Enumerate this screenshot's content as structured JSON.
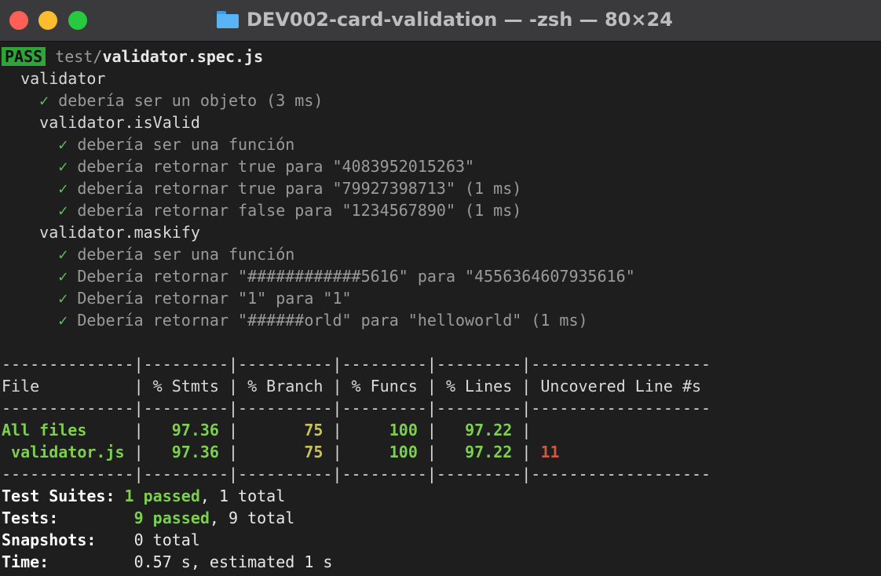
{
  "window": {
    "title": "DEV002-card-validation — -zsh — 80×24",
    "folder_icon": "folder-icon"
  },
  "run": {
    "status": "PASS",
    "file_dir": "test/",
    "file_name": "validator.spec.js"
  },
  "suite": {
    "name": "validator",
    "tests": [
      {
        "check": "✓",
        "text": "debería ser un objeto (3 ms)"
      }
    ],
    "groups": [
      {
        "name": "validator.isValid",
        "tests": [
          {
            "check": "✓",
            "text": "debería ser una función"
          },
          {
            "check": "✓",
            "text": "debería retornar true para \"4083952015263\""
          },
          {
            "check": "✓",
            "text": "debería retornar true para \"79927398713\" (1 ms)"
          },
          {
            "check": "✓",
            "text": "debería retornar false para \"1234567890\" (1 ms)"
          }
        ]
      },
      {
        "name": "validator.maskify",
        "tests": [
          {
            "check": "✓",
            "text": "debería ser una función"
          },
          {
            "check": "✓",
            "text": "Debería retornar \"############5616\" para \"4556364607935616\""
          },
          {
            "check": "✓",
            "text": "Debería retornar \"1\" para \"1\""
          },
          {
            "check": "✓",
            "text": "Debería retornar \"######orld\" para \"helloworld\" (1 ms)"
          }
        ]
      }
    ]
  },
  "coverage": {
    "separator": "--------------|---------|----------|---------|---------|-------------------",
    "headers": [
      "File",
      "% Stmts",
      "% Branch",
      "% Funcs",
      "% Lines",
      "Uncovered Line #s"
    ],
    "rows": [
      {
        "file": "All files",
        "stmts": "97.36",
        "branch": "75",
        "funcs": "100",
        "lines": "97.22",
        "uncovered": ""
      },
      {
        "file": " validator.js",
        "stmts": "97.36",
        "branch": "75",
        "funcs": "100",
        "lines": "97.22",
        "uncovered": "11"
      }
    ]
  },
  "summary": {
    "suites": {
      "label": "Test Suites:",
      "passed": "1 passed",
      "rest": ", 1 total"
    },
    "tests": {
      "label": "Tests:",
      "passed": "9 passed",
      "rest": ", 9 total"
    },
    "snapshots": {
      "label": "Snapshots:",
      "value": "0 total"
    },
    "time": {
      "label": "Time:",
      "value": "0.57 s, estimated 1 s"
    }
  },
  "colors": {
    "pass_badge": "#2ea43a",
    "check": "#5fbf5a",
    "high_coverage": "#7ccf4f",
    "medium_coverage": "#c9c15a",
    "uncovered": "#d0583b",
    "background": "#1e1e1e"
  }
}
